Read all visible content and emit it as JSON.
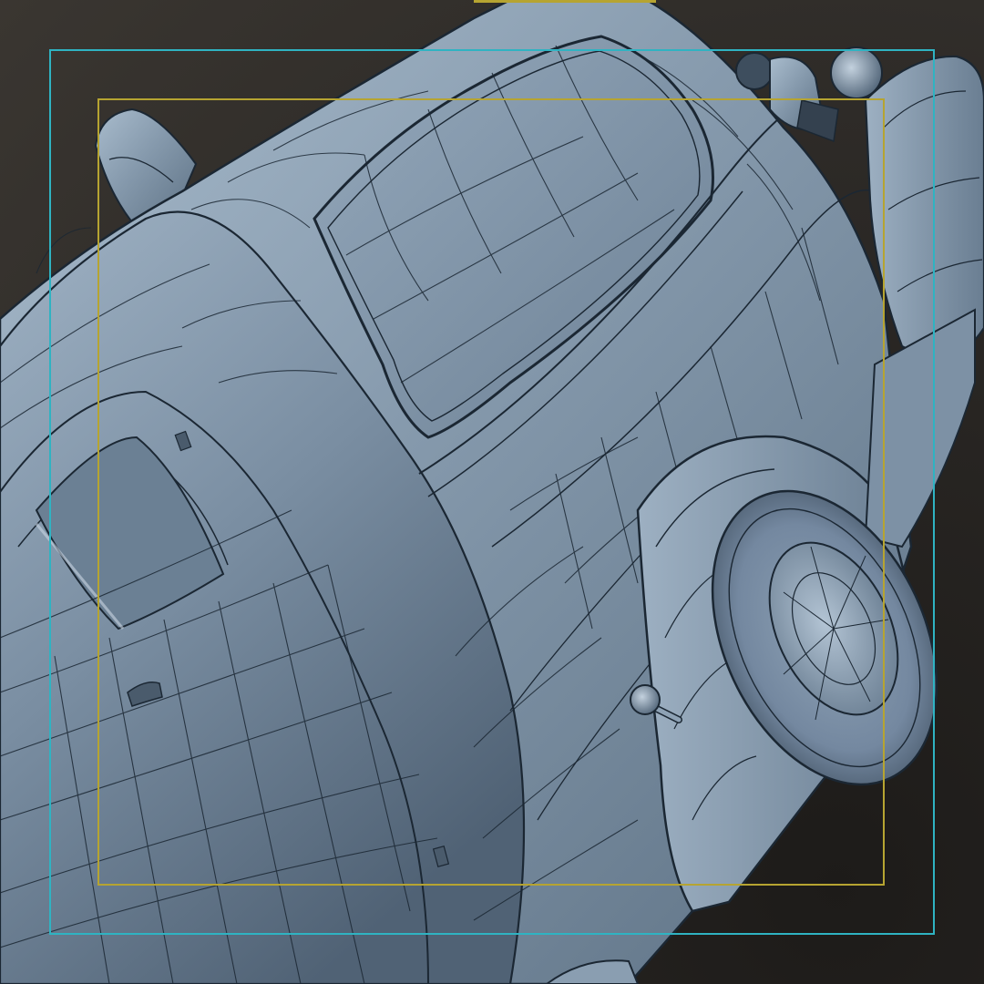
{
  "viewport": {
    "view": "perspective",
    "shading": "clay-with-wireframe",
    "subject": "vintage-car-rear-three-quarter",
    "colors": {
      "background": "#2c2926",
      "surface": "#7f93a6",
      "surface_highlight": "#b5c6d6",
      "surface_shadow": "#3f5061",
      "wire": "#1b2733",
      "safe_title_guide": "#b6a431",
      "safe_action_guide": "#2fb3c2"
    }
  },
  "guides": {
    "safe_title": "title-safe-frame",
    "safe_action": "action-safe-frame"
  }
}
